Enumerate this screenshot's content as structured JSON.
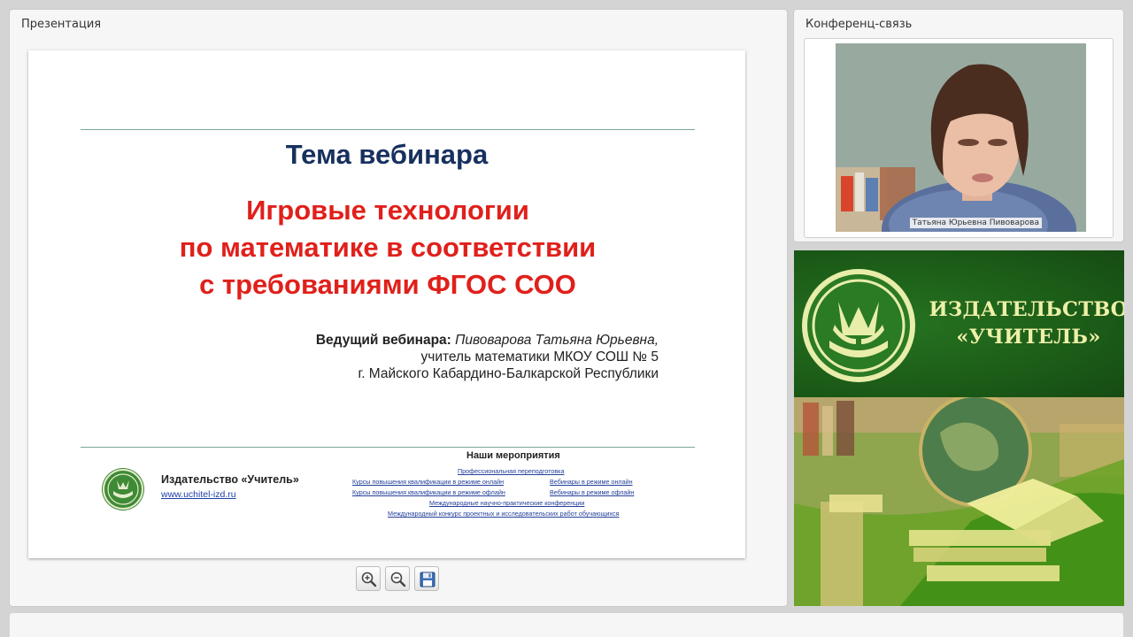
{
  "presentation_panel": {
    "title": "Презентация"
  },
  "slide": {
    "heading": "Тема вебинара",
    "topic_lines": [
      "Игровые технологии",
      "по математике в соответствии",
      "с требованиями ФГОС СОО"
    ],
    "host_label": "Ведущий вебинара:",
    "host_name": "Пивоварова Татьяна Юрьевна,",
    "host_line2": "учитель математики МКОУ СОШ № 5",
    "host_line3": "г. Майского Кабардино-Балкарской Республики",
    "footer": {
      "publisher": "Издательство «Учитель»",
      "url": "www.uchitel-izd.ru",
      "events_title": "Наши мероприятия",
      "events": [
        "Профессиональная переподготовка",
        "Курсы повышения квалификации в режиме онлайн",
        "Вебинары в режиме онлайн",
        "Курсы повышения квалификации в режиме офлайн",
        "Вебинары в режиме офлайн",
        "Международные научно-практические конференции",
        "Международный конкурс проектных и исследовательских работ обучающихся"
      ]
    }
  },
  "toolbar": {
    "zoom_in_icon": "zoom-in-icon",
    "zoom_out_icon": "zoom-out-icon",
    "save_icon": "floppy-disk-icon"
  },
  "conference_panel": {
    "title": "Конференц-связь",
    "presenter_name": "Татьяна Юрьевна Пивоварова"
  },
  "banner": {
    "line1": "ИЗДАТЕЛЬСТВО",
    "line2": "«УЧИТЕЛЬ»",
    "text_color": "#eef0a8",
    "bg_color": "#1d5f19"
  },
  "colors": {
    "heading": "#17305e",
    "topic": "#e0201b",
    "link": "#24409a"
  }
}
